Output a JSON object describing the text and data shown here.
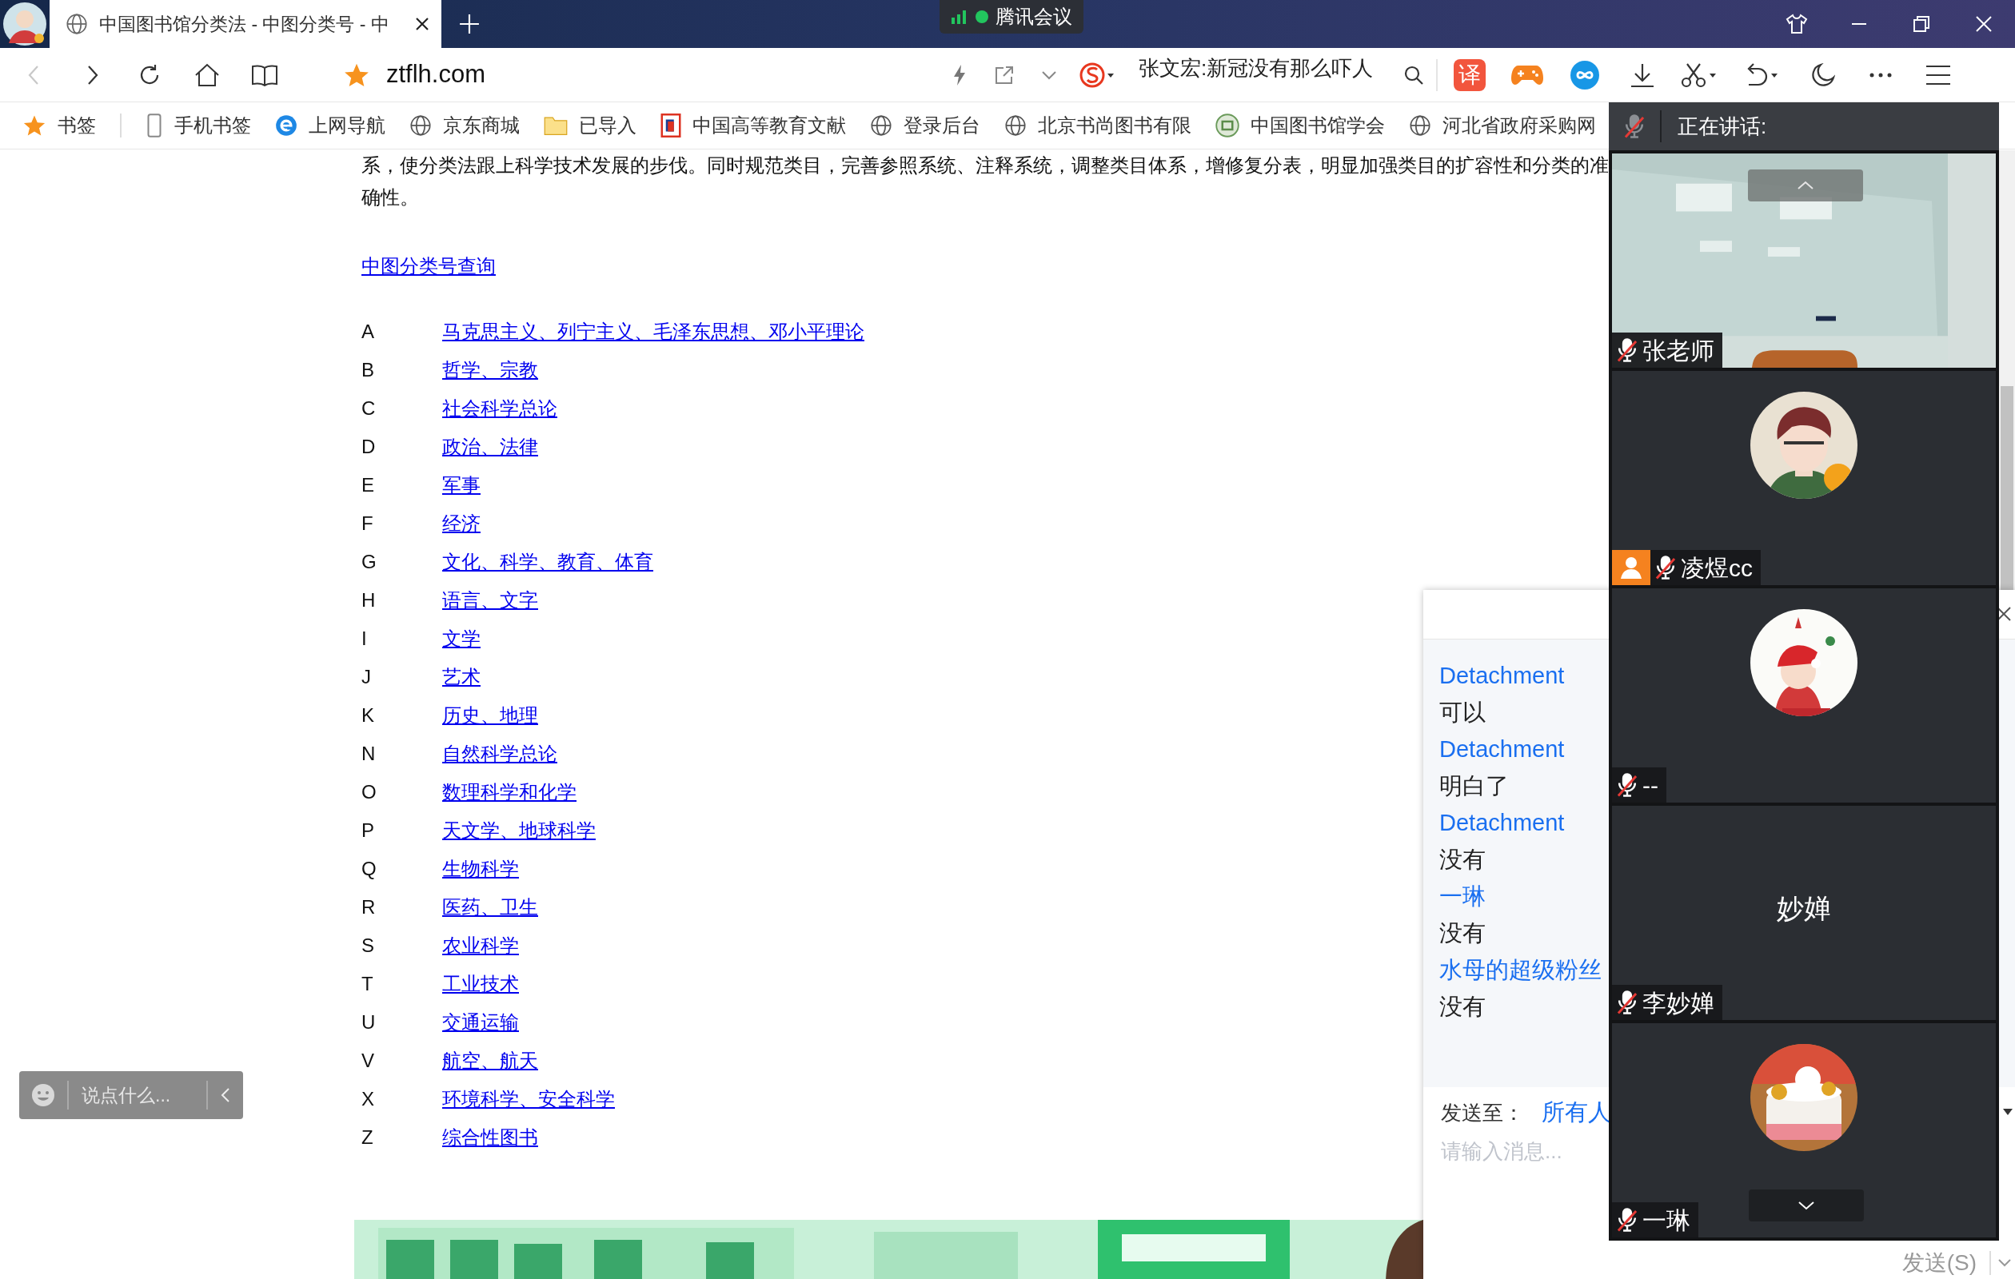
{
  "browser": {
    "tabs": [
      {
        "title": "中国图书馆分类法 - 中图分类号 - 中",
        "selected": true
      }
    ],
    "meeting_app": {
      "title": "腾讯会议"
    },
    "nav": [
      {
        "kind": "back",
        "disabled": true
      },
      {
        "kind": "forward",
        "disabled": false
      }
    ],
    "address": "ztflh.com",
    "search_suggestion": "张文宏:新冠没有那么吓人",
    "translate_label": "译",
    "bookmarks": [
      {
        "kind": "star",
        "label": "书签"
      },
      {
        "kind": "phone",
        "label": "手机书签"
      },
      {
        "kind": "ie",
        "label": "上网导航"
      },
      {
        "kind": "globe",
        "label": "京东商城"
      },
      {
        "kind": "folder",
        "label": "已导入"
      },
      {
        "kind": "doc",
        "label": "中国高等教育文献"
      },
      {
        "kind": "globe",
        "label": "登录后台"
      },
      {
        "kind": "globe",
        "label": "北京书尚图书有限"
      },
      {
        "kind": "badge",
        "label": "中国图书馆学会"
      },
      {
        "kind": "globe",
        "label": "河北省政府采购网"
      }
    ]
  },
  "page": {
    "paragraph_lines": [
      "系，使分类法跟上科学技术发展的步伐。同时规范类目，完善参照系统、注释系统，调整类目体系，增修复分表，明显加强类目的扩容性和分类的准",
      "确性。"
    ],
    "query_link": "中图分类号查询",
    "categories": [
      {
        "code": "A",
        "name": "马克思主义、列宁主义、毛泽东思想、邓小平理论"
      },
      {
        "code": "B",
        "name": "哲学、宗教"
      },
      {
        "code": "C",
        "name": "社会科学总论"
      },
      {
        "code": "D",
        "name": "政治、法律"
      },
      {
        "code": "E",
        "name": "军事"
      },
      {
        "code": "F",
        "name": "经济"
      },
      {
        "code": "G",
        "name": "文化、科学、教育、体育"
      },
      {
        "code": "H",
        "name": "语言、文字"
      },
      {
        "code": "I",
        "name": "文学"
      },
      {
        "code": "J",
        "name": "艺术"
      },
      {
        "code": "K",
        "name": "历史、地理"
      },
      {
        "code": "N",
        "name": "自然科学总论"
      },
      {
        "code": "O",
        "name": "数理科学和化学"
      },
      {
        "code": "P",
        "name": "天文学、地球科学"
      },
      {
        "code": "Q",
        "name": "生物科学"
      },
      {
        "code": "R",
        "name": "医药、卫生"
      },
      {
        "code": "S",
        "name": "农业科学"
      },
      {
        "code": "T",
        "name": "工业技术"
      },
      {
        "code": "U",
        "name": "交通运输"
      },
      {
        "code": "V",
        "name": "航空、航天"
      },
      {
        "code": "X",
        "name": "环境科学、安全科学"
      },
      {
        "code": "Z",
        "name": "综合性图书"
      }
    ],
    "comment_box": {
      "placeholder": "说点什么..."
    }
  },
  "chat": {
    "messages": [
      {
        "sender": "Detachment",
        "text": "可以"
      },
      {
        "sender": "Detachment",
        "text": "明白了"
      },
      {
        "sender": "Detachment",
        "text": "没有"
      },
      {
        "sender": "一琳",
        "text": "没有"
      },
      {
        "sender": "水母的超级粉丝",
        "text": "没有"
      }
    ],
    "send_to_label": "发送至：",
    "recipient": "所有人",
    "input": {
      "placeholder": "请输入消息..."
    },
    "send_button": "发送(S)"
  },
  "meeting": {
    "speaking_label": "正在讲话:",
    "participants": [
      {
        "name": "张老师",
        "kind": "video",
        "muted": true,
        "is_self": false
      },
      {
        "name": "凌煜cc",
        "kind": "avatar",
        "muted": true,
        "is_self": true
      },
      {
        "name": "--",
        "kind": "avatar",
        "muted": true,
        "is_self": false
      },
      {
        "name": "李妙婵",
        "kind": "initials",
        "display_text": "妙婵",
        "muted": true,
        "is_self": false
      },
      {
        "name": "一琳",
        "kind": "avatar",
        "muted": true,
        "is_self": false
      }
    ]
  }
}
